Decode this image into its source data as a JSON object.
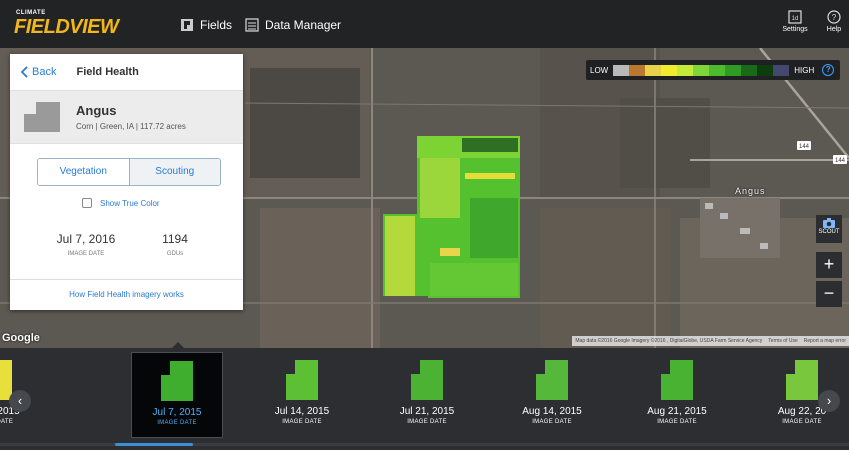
{
  "header": {
    "logo_small": "CLIMATE",
    "logo_big": "FIELDVIEW",
    "nav": [
      {
        "label": "Fields",
        "icon": "fields-icon"
      },
      {
        "label": "Data Manager",
        "icon": "data-manager-icon"
      }
    ],
    "settings_label": "Settings",
    "help_label": "Help"
  },
  "legend": {
    "low": "LOW",
    "high": "HIGH",
    "colors": [
      "#b9b9b9",
      "#b8782e",
      "#e8d24a",
      "#f0ee2c",
      "#c6e93a",
      "#7fd63a",
      "#4dbb2e",
      "#2f9a24",
      "#1b6a1a",
      "#0d3d0e",
      "#44476e"
    ]
  },
  "map": {
    "town": "Angus",
    "google": "Google",
    "attribution": [
      "Map data ©2016 Google Imagery ©2016 , DigitalGlobe, USDA Farm Service Agency",
      "Terms of Use",
      "Report a map error"
    ],
    "scout_label": "SCOUT",
    "zoom_in": "+",
    "zoom_out": "−",
    "road_badges": [
      "144",
      "144"
    ]
  },
  "panel": {
    "back": "Back",
    "title": "Field Health",
    "field_name": "Angus",
    "field_meta": "Corn | Green, IA | 117.72 acres",
    "tabs": [
      "Vegetation",
      "Scouting"
    ],
    "active_tab": "Vegetation",
    "true_color": "Show True Color",
    "image_date": "Jul 7, 2016",
    "image_date_label": "IMAGE DATE",
    "gdus": "1194",
    "gdus_label": "GDUs",
    "footer_link": "How Field Health imagery works"
  },
  "timeline": {
    "sub_label": "IMAGE DATE",
    "items": [
      {
        "date": "n 21, 2015",
        "sub": "IAGE DATE",
        "thumb": "#e7df3a",
        "selected": false
      },
      {
        "date": "Jul 7, 2015",
        "sub": "IMAGE DATE",
        "thumb": "#3fae2e",
        "selected": true
      },
      {
        "date": "Jul 14, 2015",
        "sub": "IMAGE DATE",
        "thumb": "#5cbf34",
        "selected": false
      },
      {
        "date": "Jul 21, 2015",
        "sub": "IMAGE DATE",
        "thumb": "#4cb233",
        "selected": false
      },
      {
        "date": "Aug 14, 2015",
        "sub": "IMAGE DATE",
        "thumb": "#56b83a",
        "selected": false
      },
      {
        "date": "Aug 21, 2015",
        "sub": "IMAGE DATE",
        "thumb": "#49b232",
        "selected": false
      },
      {
        "date": "Aug 22, 20",
        "sub": "IMAGE DATE",
        "thumb": "#79c73c",
        "selected": false
      }
    ]
  }
}
